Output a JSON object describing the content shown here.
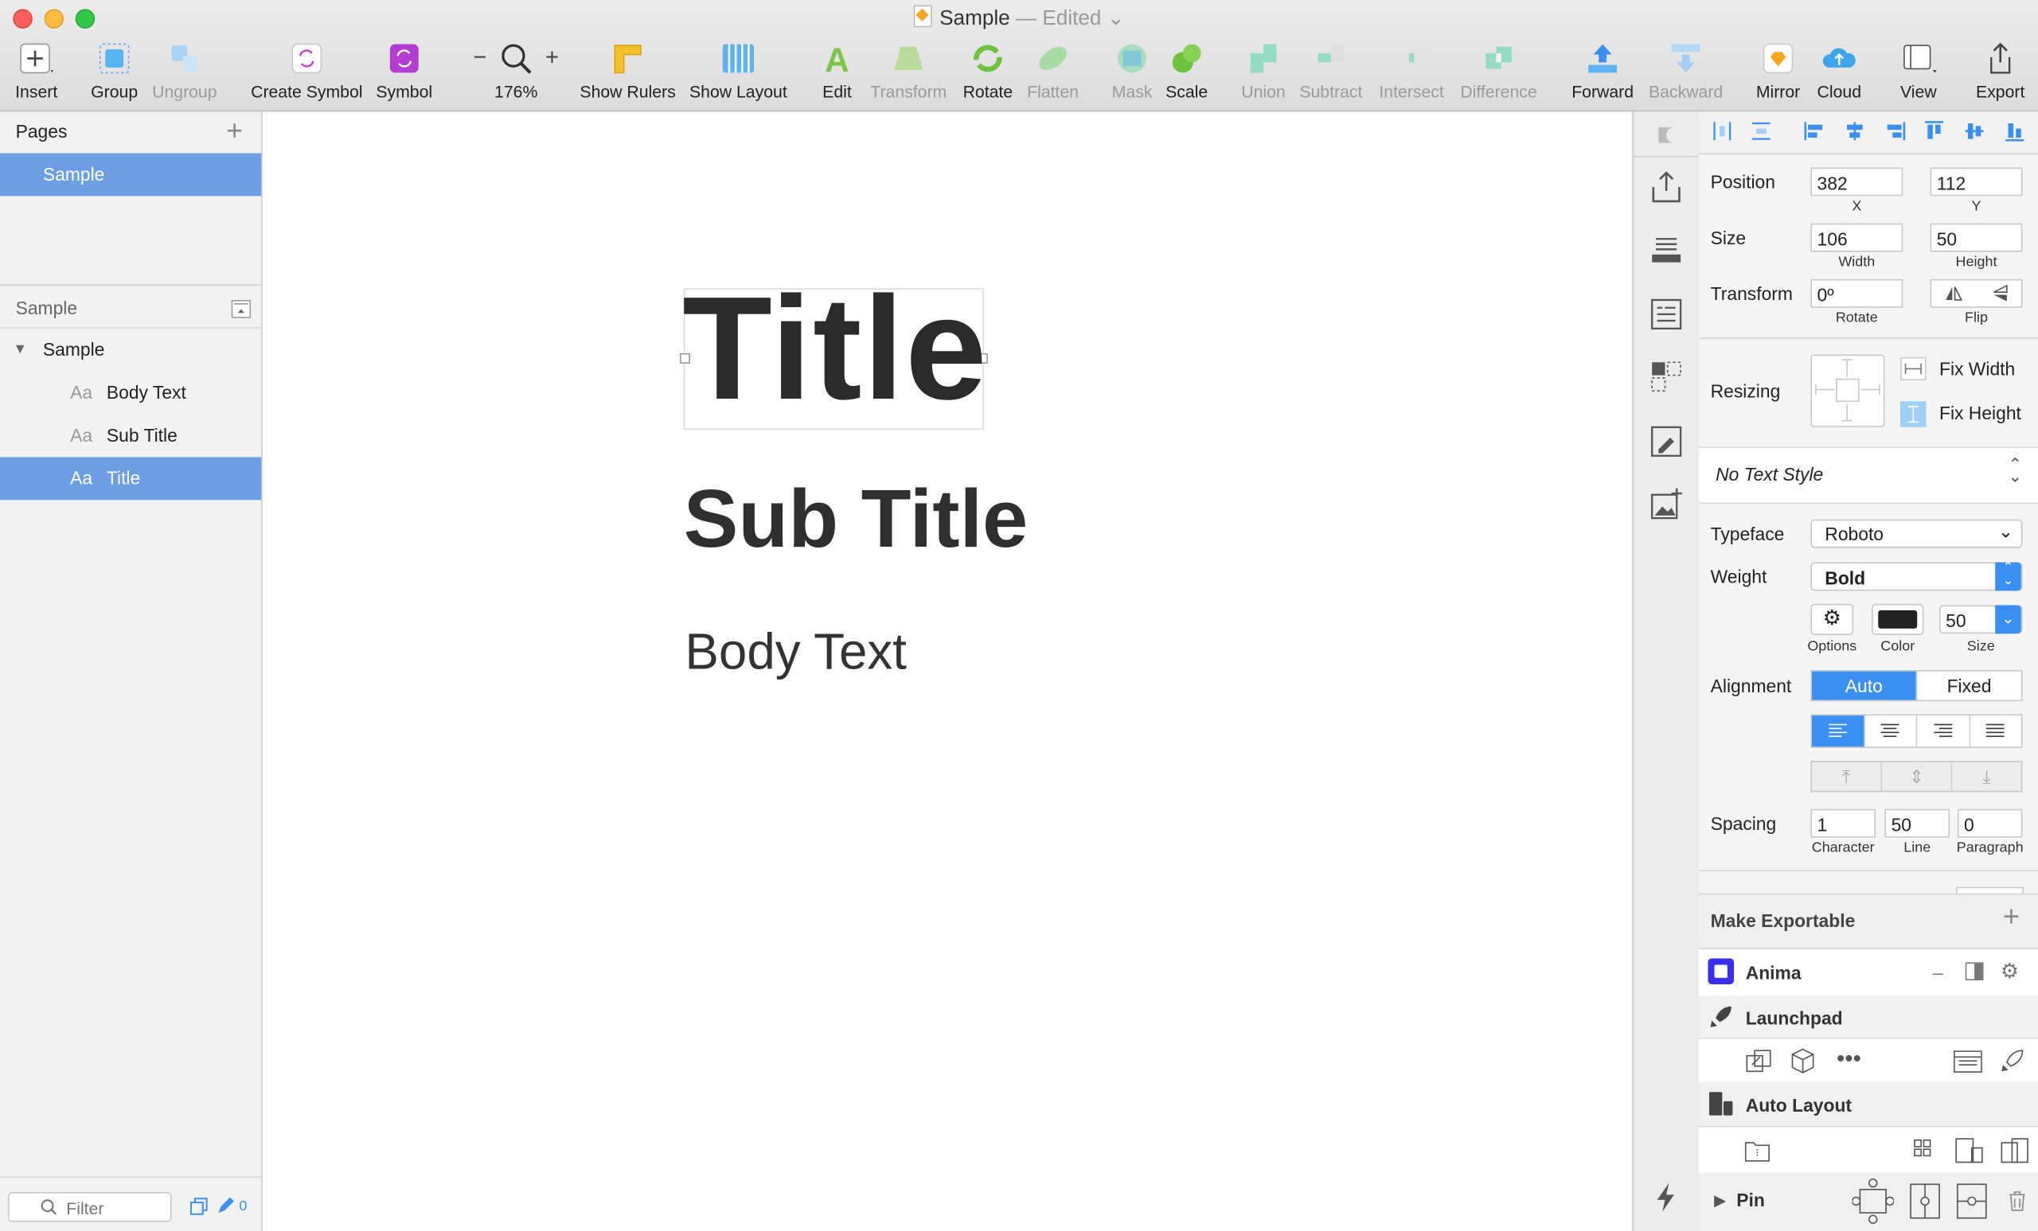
{
  "window": {
    "title": "Sample",
    "edited": "— Edited"
  },
  "toolbar": {
    "insert": "Insert",
    "group": "Group",
    "ungroup": "Ungroup",
    "create_symbol": "Create Symbol",
    "symbol": "Symbol",
    "zoom": "176%",
    "zoom_minus": "−",
    "zoom_plus": "+",
    "show_rulers": "Show Rulers",
    "show_layout": "Show Layout",
    "edit": "Edit",
    "transform": "Transform",
    "rotate": "Rotate",
    "flatten": "Flatten",
    "mask": "Mask",
    "scale": "Scale",
    "union": "Union",
    "subtract": "Subtract",
    "intersect": "Intersect",
    "difference": "Difference",
    "forward": "Forward",
    "backward": "Backward",
    "mirror": "Mirror",
    "cloud": "Cloud",
    "view": "View",
    "export": "Export"
  },
  "pages": {
    "header": "Pages",
    "add": "+",
    "items": [
      {
        "label": "Sample",
        "selected": true
      }
    ]
  },
  "layers": {
    "header": "Sample",
    "group": "Sample",
    "items": [
      {
        "prefix": "Aa",
        "label": "Body Text",
        "selected": false
      },
      {
        "prefix": "Aa",
        "label": "Sub Title",
        "selected": false
      },
      {
        "prefix": "Aa",
        "label": "Title",
        "selected": true
      }
    ],
    "filter_placeholder": "Filter",
    "badge_count": "0"
  },
  "canvas": {
    "title": "Title",
    "subtitle": "Sub Title",
    "body": "Body Text"
  },
  "inspector": {
    "position": {
      "label": "Position",
      "x": "382",
      "y": "112",
      "x_label": "X",
      "y_label": "Y"
    },
    "size": {
      "label": "Size",
      "width": "106",
      "height": "50",
      "width_label": "Width",
      "height_label": "Height"
    },
    "transform": {
      "label": "Transform",
      "rotate": "0º",
      "rotate_label": "Rotate",
      "flip_label": "Flip"
    },
    "resizing": {
      "label": "Resizing",
      "fix_width": "Fix Width",
      "fix_height": "Fix Height"
    },
    "text_style": "No Text Style",
    "typeface": {
      "label": "Typeface",
      "value": "Roboto"
    },
    "weight": {
      "label": "Weight",
      "value": "Bold"
    },
    "options_label": "Options",
    "color_label": "Color",
    "size_label": "Size",
    "font_size": "50",
    "alignment": {
      "label": "Alignment",
      "auto": "Auto",
      "fixed": "Fixed"
    },
    "spacing": {
      "label": "Spacing",
      "character": "1",
      "line": "50",
      "paragraph": "0",
      "character_label": "Character",
      "line_label": "Line",
      "paragraph_label": "Paragraph"
    },
    "make_exportable": "Make Exportable",
    "plugins": {
      "anima": "Anima",
      "launchpad": "Launchpad",
      "auto_layout": "Auto Layout",
      "pin": "Pin"
    }
  },
  "colors": {
    "accent": "#3b8ff2",
    "selection": "#6d9ee4",
    "text_color": "#222222"
  }
}
